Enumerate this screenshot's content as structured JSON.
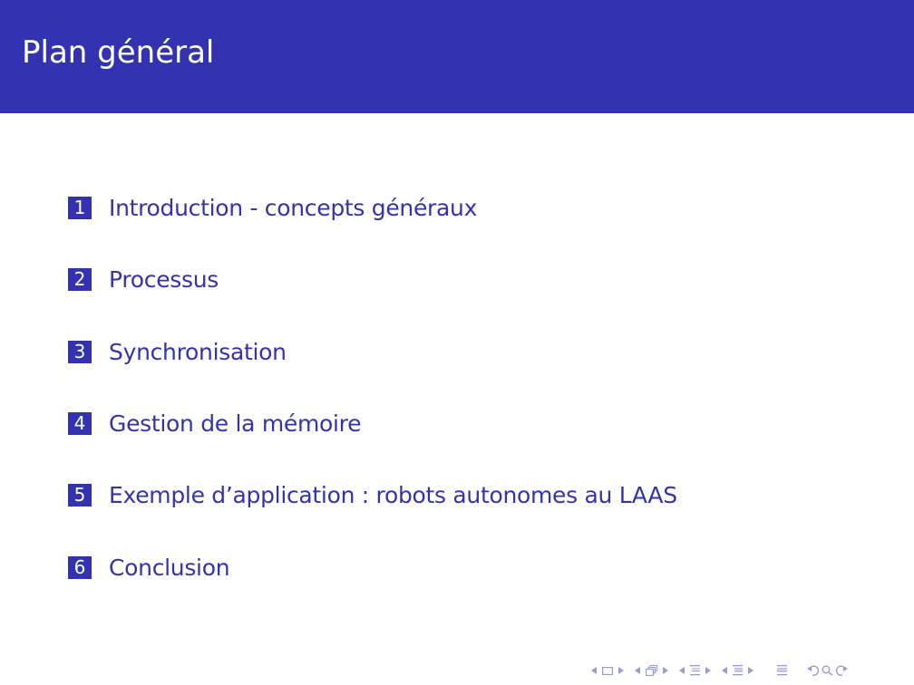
{
  "slide": {
    "title": "Plan général",
    "accent_color": "#3333b2"
  },
  "toc": {
    "items": [
      {
        "number": "1",
        "label": "Introduction - concepts généraux"
      },
      {
        "number": "2",
        "label": "Processus"
      },
      {
        "number": "3",
        "label": "Synchronisation"
      },
      {
        "number": "4",
        "label": "Gestion de la mémoire"
      },
      {
        "number": "5",
        "label": "Exemple d’application : robots autonomes au LAAS"
      },
      {
        "number": "6",
        "label": "Conclusion"
      }
    ]
  },
  "navigation": {
    "icons": [
      "prev-slide-arrow",
      "slide-icon",
      "next-slide-arrow",
      "prev-frame-arrow",
      "frame-icon",
      "next-frame-arrow",
      "prev-subsection-arrow",
      "subsection-icon",
      "next-subsection-arrow",
      "prev-section-arrow",
      "section-icon",
      "next-section-arrow",
      "document-icon",
      "back-icon",
      "search-icon",
      "forward-icon"
    ]
  }
}
